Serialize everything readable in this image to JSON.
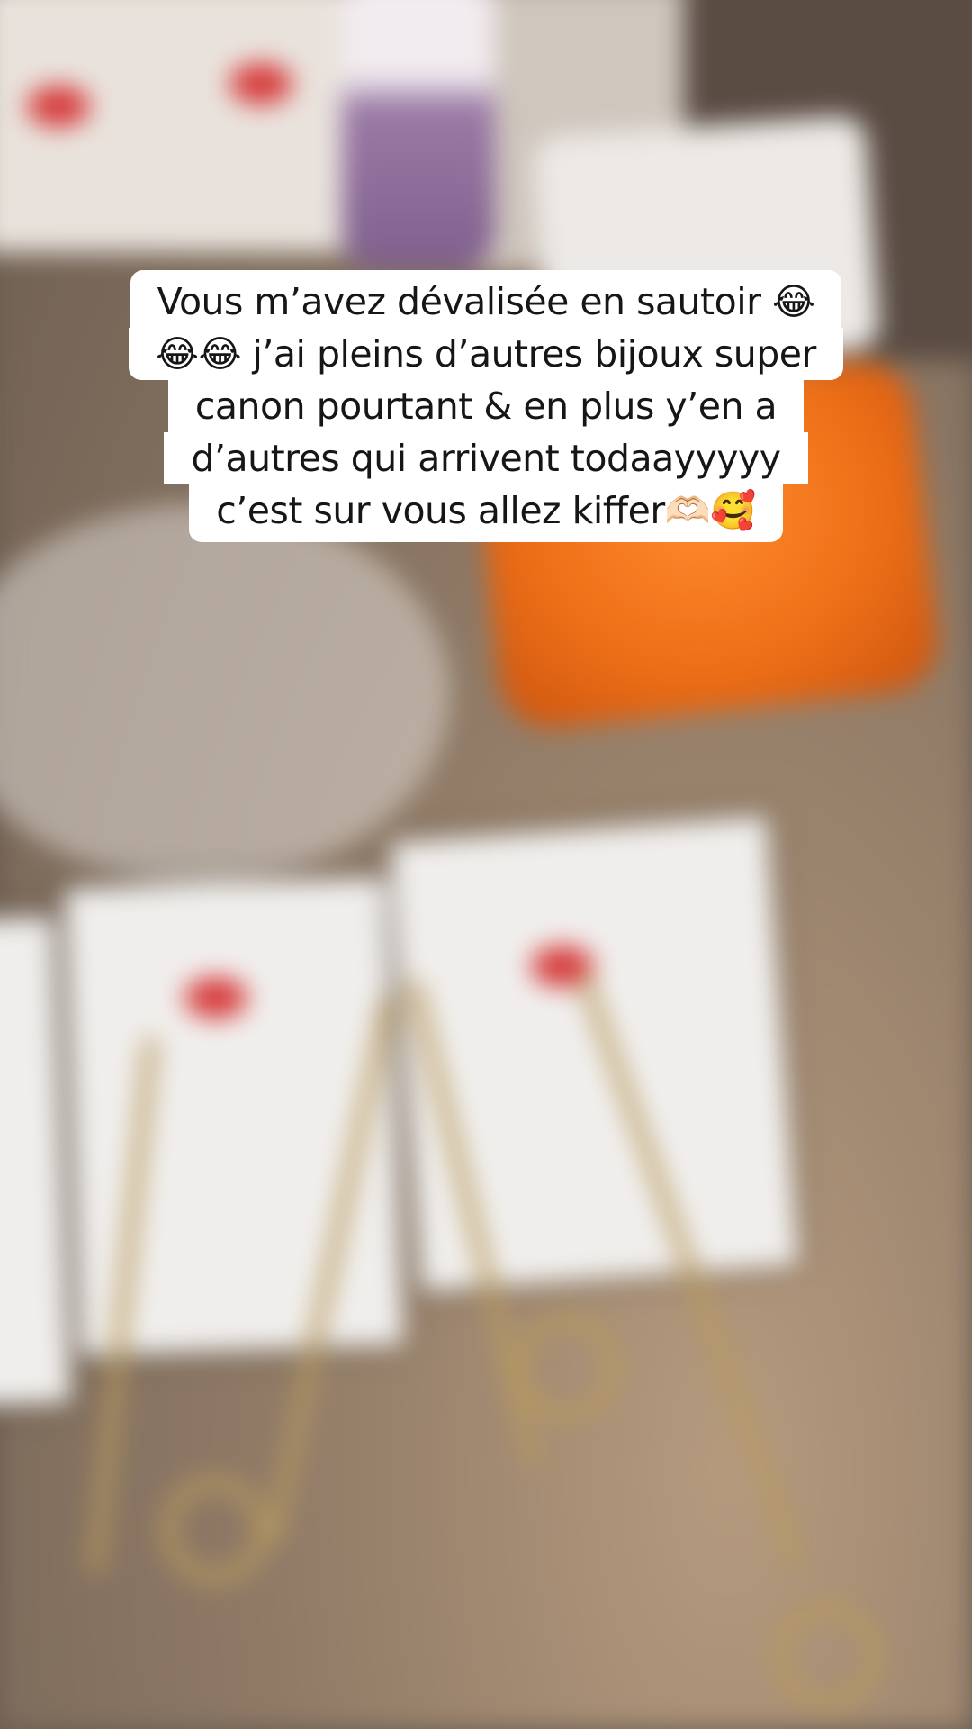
{
  "caption": {
    "lines": [
      "Vous m’avez dévalisée en sautoir 😂",
      "😂😂 j’ai pleins d’autres bijoux super",
      "canon pourtant & en plus y’en a",
      "d’autres qui arrivent todaayyyyy",
      "c’est sur vous allez kiffer🫶🏻🥰"
    ]
  },
  "colors": {
    "caption_bg": "#ffffff",
    "caption_text": "#161616",
    "accent_orange": "#ee6f17"
  }
}
